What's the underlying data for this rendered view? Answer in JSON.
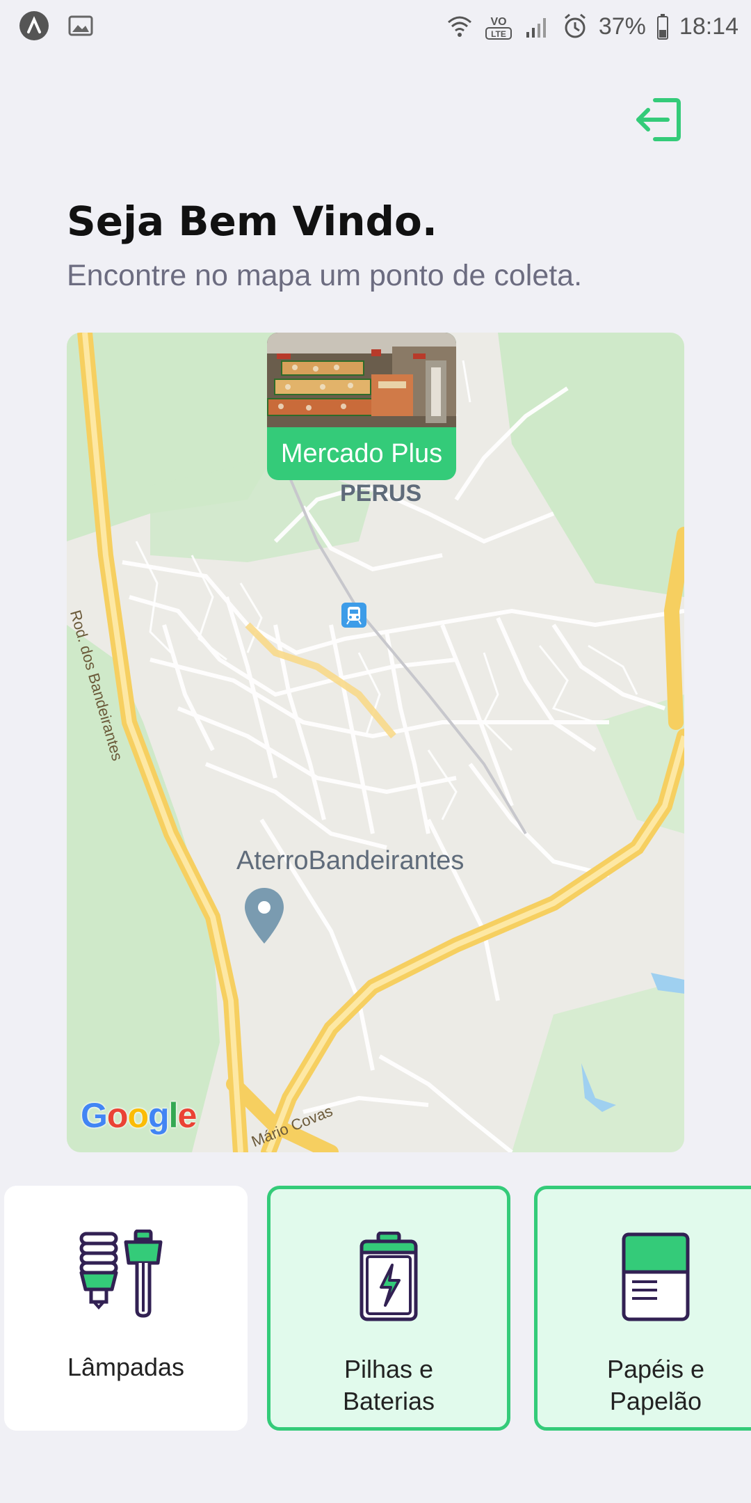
{
  "status_bar": {
    "battery": "37%",
    "time": "18:14",
    "network": "VoLTE"
  },
  "header": {
    "title": "Seja Bem Vindo.",
    "subtitle": "Encontre no mapa um ponto de coleta."
  },
  "map": {
    "marker": {
      "name": "Mercado Plus"
    },
    "labels": {
      "district": "PERUS",
      "landmark": "AterroBandeirantes",
      "road_1": "Rod. dos Bandeirantes",
      "road_2": "Mário Covas"
    },
    "attribution": "Google"
  },
  "items": [
    {
      "label": "Lâmpadas",
      "selected": false,
      "icon": "lamp-icon"
    },
    {
      "label": "Pilhas e\nBaterias",
      "selected": true,
      "icon": "battery-icon"
    },
    {
      "label": "Papéis e\nPapelão",
      "selected": true,
      "icon": "paper-icon"
    }
  ],
  "colors": {
    "accent": "#34cb79",
    "background": "#f0f0f5",
    "title": "#111111",
    "subtitle": "#6c6c80",
    "icon_dark": "#322153",
    "selected_bg": "#e1faec"
  }
}
